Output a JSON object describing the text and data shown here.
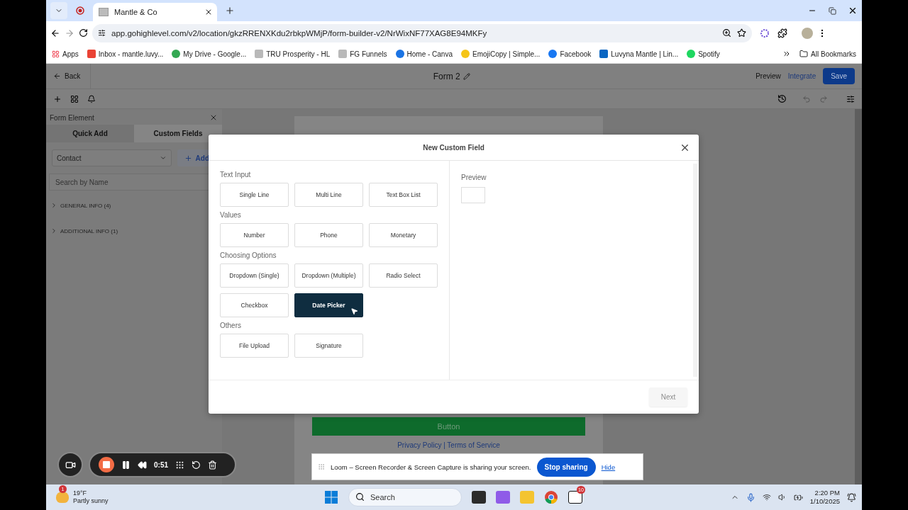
{
  "browser": {
    "tabs": [
      {
        "title": "Mantle & Co",
        "selected": true
      }
    ],
    "url": "app.gohighlevel.com/v2/location/gkzRRENXKdu2rbkpWMjP/form-builder-v2/NrWixNF77XAG8E94MKFy",
    "bookmarks": [
      {
        "label": "Apps",
        "kind": "apps"
      },
      {
        "label": "Inbox - mantle.luvy...",
        "kind": "mail"
      },
      {
        "label": "My Drive - Google...",
        "kind": "drive"
      },
      {
        "label": "TRU Prosperity - HL",
        "kind": "site"
      },
      {
        "label": "FG Funnels",
        "kind": "site"
      },
      {
        "label": "Home - Canva",
        "kind": "canva"
      },
      {
        "label": "EmojiCopy | Simple...",
        "kind": "emoji"
      },
      {
        "label": "Facebook",
        "kind": "facebook"
      },
      {
        "label": "Luvyna Mantle | Lin...",
        "kind": "linkedin"
      },
      {
        "label": "Spotify",
        "kind": "spotify"
      }
    ],
    "all_bookmarks": "All Bookmarks"
  },
  "header": {
    "back": "Back",
    "title": "Form 2",
    "preview": "Preview",
    "integrate": "Integrate",
    "save": "Save"
  },
  "left_panel": {
    "title": "Form Element",
    "tabs": [
      {
        "label": "Quick Add",
        "selected": false
      },
      {
        "label": "Custom Fields",
        "selected": true
      }
    ],
    "object_select": "Contact",
    "add": "Add",
    "search": {
      "placeholder": "Search by Name"
    },
    "groups": [
      {
        "label": "GENERAL INFO (4)",
        "expanded": false
      },
      {
        "label": "ADDITIONAL INFO (1)",
        "expanded": false
      }
    ]
  },
  "canvas": {
    "submit_button": "Button",
    "footer_links": "Privacy Policy | Terms of Service"
  },
  "modal": {
    "title": "New Custom Field",
    "sections": [
      {
        "title": "Text Input",
        "options": [
          {
            "label": "Single Line",
            "selected": false
          },
          {
            "label": "Multi Line",
            "selected": false
          },
          {
            "label": "Text Box List",
            "selected": false
          }
        ]
      },
      {
        "title": "Values",
        "options": [
          {
            "label": "Number",
            "selected": false
          },
          {
            "label": "Phone",
            "selected": false
          },
          {
            "label": "Monetary",
            "selected": false
          }
        ]
      },
      {
        "title": "Choosing Options",
        "options": [
          {
            "label": "Dropdown (Single)",
            "selected": false
          },
          {
            "label": "Dropdown (Multiple)",
            "selected": false
          },
          {
            "label": "Radio Select",
            "selected": false
          },
          {
            "label": "Checkbox",
            "selected": false
          },
          {
            "label": "Date Picker",
            "selected": true
          }
        ]
      },
      {
        "title": "Others",
        "options": [
          {
            "label": "File Upload",
            "selected": false
          },
          {
            "label": "Signature",
            "selected": false
          }
        ]
      }
    ],
    "preview_label": "Preview",
    "next": {
      "label": "Next",
      "disabled": true
    }
  },
  "recorder": {
    "time": "0:51"
  },
  "sharing_bar": {
    "message": "Loom – Screen Recorder & Screen Capture is sharing your screen.",
    "stop": "Stop sharing",
    "hide": "Hide"
  },
  "taskbar": {
    "weather_badge": "1",
    "temperature": "19°F",
    "condition": "Partly sunny",
    "search": {
      "placeholder": "Search"
    },
    "notion_badge": "10",
    "time": "2:20 PM",
    "date": "1/10/2025"
  }
}
